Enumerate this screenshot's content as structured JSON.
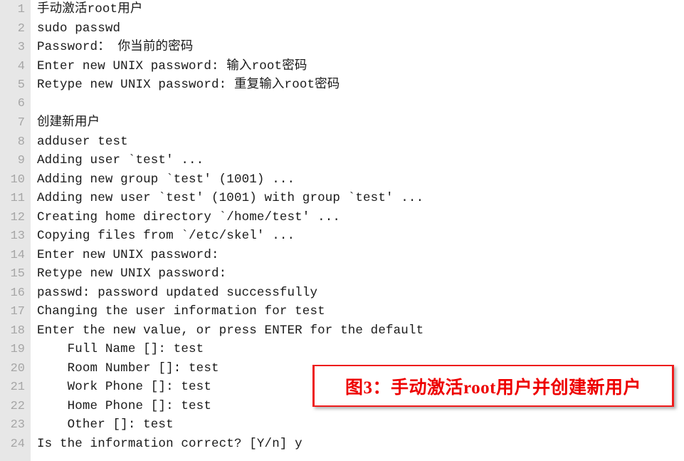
{
  "code_block": {
    "language_style": "shell-transcript",
    "gutter": {
      "background_color": "#e7e7e7",
      "number_color": "#a6a6a6"
    },
    "text_color": "#1a1a1a",
    "lines": [
      {
        "no": "1",
        "text": "手动激活root用户"
      },
      {
        "no": "2",
        "text": "sudo passwd"
      },
      {
        "no": "3",
        "text": "Password： 你当前的密码"
      },
      {
        "no": "4",
        "text": "Enter new UNIX password: 输入root密码"
      },
      {
        "no": "5",
        "text": "Retype new UNIX password: 重复输入root密码"
      },
      {
        "no": "6",
        "text": ""
      },
      {
        "no": "7",
        "text": "创建新用户"
      },
      {
        "no": "8",
        "text": "adduser test"
      },
      {
        "no": "9",
        "text": "Adding user `test' ..."
      },
      {
        "no": "10",
        "text": "Adding new group `test' (1001) ..."
      },
      {
        "no": "11",
        "text": "Adding new user `test' (1001) with group `test' ..."
      },
      {
        "no": "12",
        "text": "Creating home directory `/home/test' ..."
      },
      {
        "no": "13",
        "text": "Copying files from `/etc/skel' ..."
      },
      {
        "no": "14",
        "text": "Enter new UNIX password:"
      },
      {
        "no": "15",
        "text": "Retype new UNIX password:"
      },
      {
        "no": "16",
        "text": "passwd: password updated successfully"
      },
      {
        "no": "17",
        "text": "Changing the user information for test"
      },
      {
        "no": "18",
        "text": "Enter the new value, or press ENTER for the default"
      },
      {
        "no": "19",
        "text": "    Full Name []: test"
      },
      {
        "no": "20",
        "text": "    Room Number []: test"
      },
      {
        "no": "21",
        "text": "    Work Phone []: test"
      },
      {
        "no": "22",
        "text": "    Home Phone []: test"
      },
      {
        "no": "23",
        "text": "    Other []: test"
      },
      {
        "no": "24",
        "text": "Is the information correct? [Y/n] y"
      }
    ]
  },
  "caption": {
    "text": "图3：手动激活root用户并创建新用户",
    "border_color": "#ee1c1c",
    "text_color": "#ee0000"
  }
}
